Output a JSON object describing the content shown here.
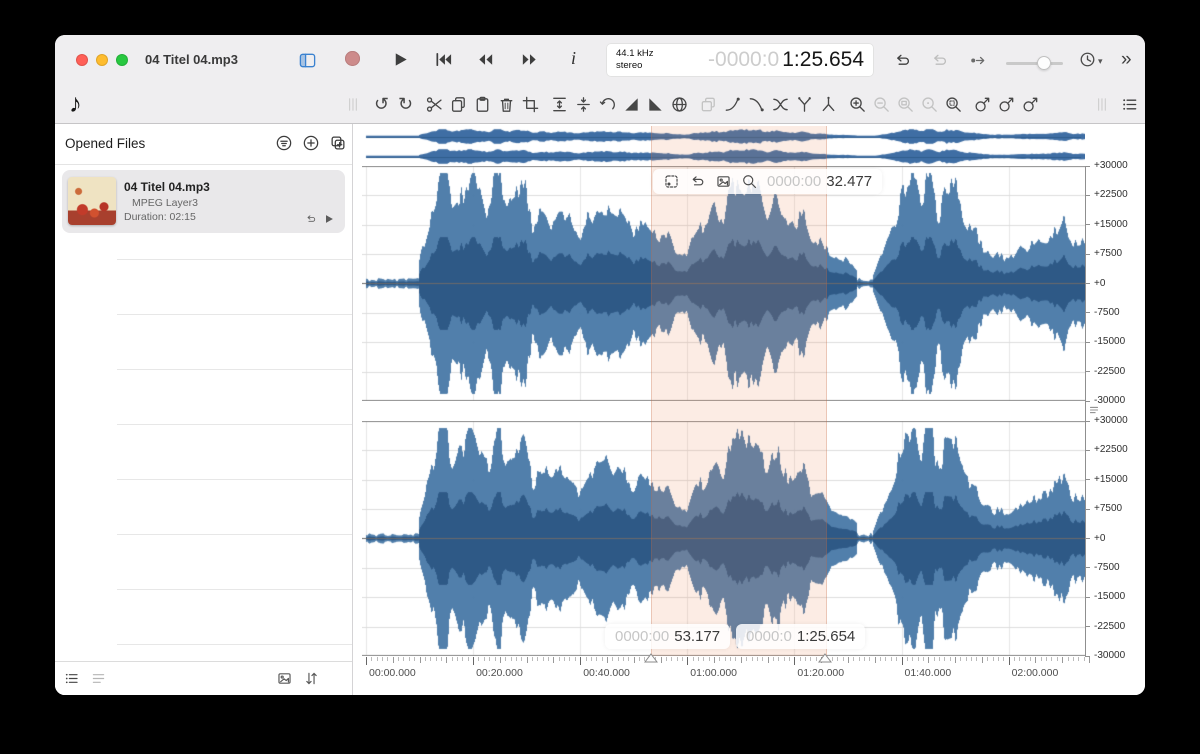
{
  "window": {
    "title": "04 Titel 04.mp3"
  },
  "icon_glyphs": {
    "music_note": "♪",
    "info": "i",
    "chevron_down": "▾",
    "more": "»",
    "undo": "↺",
    "redo": "↻"
  },
  "colors": {
    "accent_blue": "#3b82d0",
    "record_red": "#cd8b8b",
    "traffic_red": "#ff5f57",
    "traffic_yellow": "#febc2e",
    "traffic_green": "#28c840",
    "wave_blue": "rgba(72,120,166,0.95)",
    "wave_blue_dark": "rgba(45,87,133,0.95)",
    "overview_blue": "#3f6ea4",
    "selection_tint": "rgba(236,134,90,0.16)"
  },
  "toolbar": {
    "lcd": {
      "rate": "44.1 kHz",
      "mode": "stereo",
      "time_dim": "-0000:0",
      "time_main": "1:25.654"
    }
  },
  "edit_toolbar": {
    "groups": [
      [
        {
          "icon": "undo",
          "name": "undo-button",
          "enabled": true
        },
        {
          "icon": "redo",
          "name": "redo-button",
          "enabled": true
        }
      ],
      [
        {
          "icon": "scissors",
          "name": "cut-button",
          "enabled": true
        },
        {
          "icon": "copy",
          "name": "copy-button",
          "enabled": true
        },
        {
          "icon": "paste",
          "name": "paste-button",
          "enabled": true
        },
        {
          "icon": "trash",
          "name": "delete-button",
          "enabled": true
        },
        {
          "icon": "crop",
          "name": "crop-button",
          "enabled": true
        }
      ],
      [
        {
          "icon": "vfit",
          "name": "fit-amplitude-button",
          "enabled": true
        },
        {
          "icon": "vcenter",
          "name": "center-amplitude-button",
          "enabled": true
        },
        {
          "icon": "hook",
          "name": "reverse-button",
          "enabled": true
        },
        {
          "icon": "fadein",
          "name": "fade-in-button",
          "enabled": true
        },
        {
          "icon": "fadeout",
          "name": "fade-out-button",
          "enabled": true
        },
        {
          "icon": "sphere",
          "name": "normalize-button",
          "enabled": true
        }
      ],
      [
        {
          "icon": "stack",
          "name": "duplicate-button",
          "enabled": false
        },
        {
          "icon": "curveup",
          "name": "envelope-up-button",
          "enabled": true
        },
        {
          "icon": "curvedown",
          "name": "envelope-down-button",
          "enabled": true
        },
        {
          "icon": "xfade",
          "name": "crossfade-button",
          "enabled": true
        },
        {
          "icon": "ysplit",
          "name": "split-channels-button",
          "enabled": true
        },
        {
          "icon": "ymerge",
          "name": "merge-channels-button",
          "enabled": true
        }
      ],
      [
        {
          "icon": "zoomin",
          "name": "zoom-in-button",
          "enabled": true
        },
        {
          "icon": "zoomout",
          "name": "zoom-out-button",
          "enabled": false
        },
        {
          "icon": "zoomfit",
          "name": "zoom-fit-button",
          "enabled": false
        },
        {
          "icon": "zoomone",
          "name": "zoom-actual-button",
          "enabled": false
        },
        {
          "icon": "zoomsel",
          "name": "zoom-selection-button",
          "enabled": true
        }
      ],
      [
        {
          "icon": "link",
          "name": "marker-insert-button",
          "enabled": true
        },
        {
          "icon": "link",
          "name": "marker-loop-button",
          "enabled": true
        },
        {
          "icon": "link",
          "name": "marker-link-button",
          "enabled": true
        }
      ]
    ]
  },
  "sidebar": {
    "header": "Opened Files",
    "file": {
      "name": "04 Titel 04.mp3",
      "format": "MPEG Layer3",
      "duration": "Duration: 02:15"
    },
    "empty_rows": 8
  },
  "selection": {
    "length_dim": "0000:00",
    "length": "32.477",
    "start_dim": "0000:00",
    "start": "53.177",
    "end_dim": "0000:0",
    "end": "1:25.654"
  },
  "waveform": {
    "duration_sec": 135,
    "selection_start_sec": 53.177,
    "selection_end_sec": 85.654,
    "scale_labels": [
      "+30000",
      "+22500",
      "+15000",
      "+7500",
      "+0",
      "-7500",
      "-15000",
      "-22500",
      "-30000"
    ],
    "timeline_labels": [
      "00:00.000",
      "00:20.000",
      "00:40.000",
      "01:00.000",
      "01:20.000",
      "01:40.000",
      "02:00.000"
    ]
  }
}
